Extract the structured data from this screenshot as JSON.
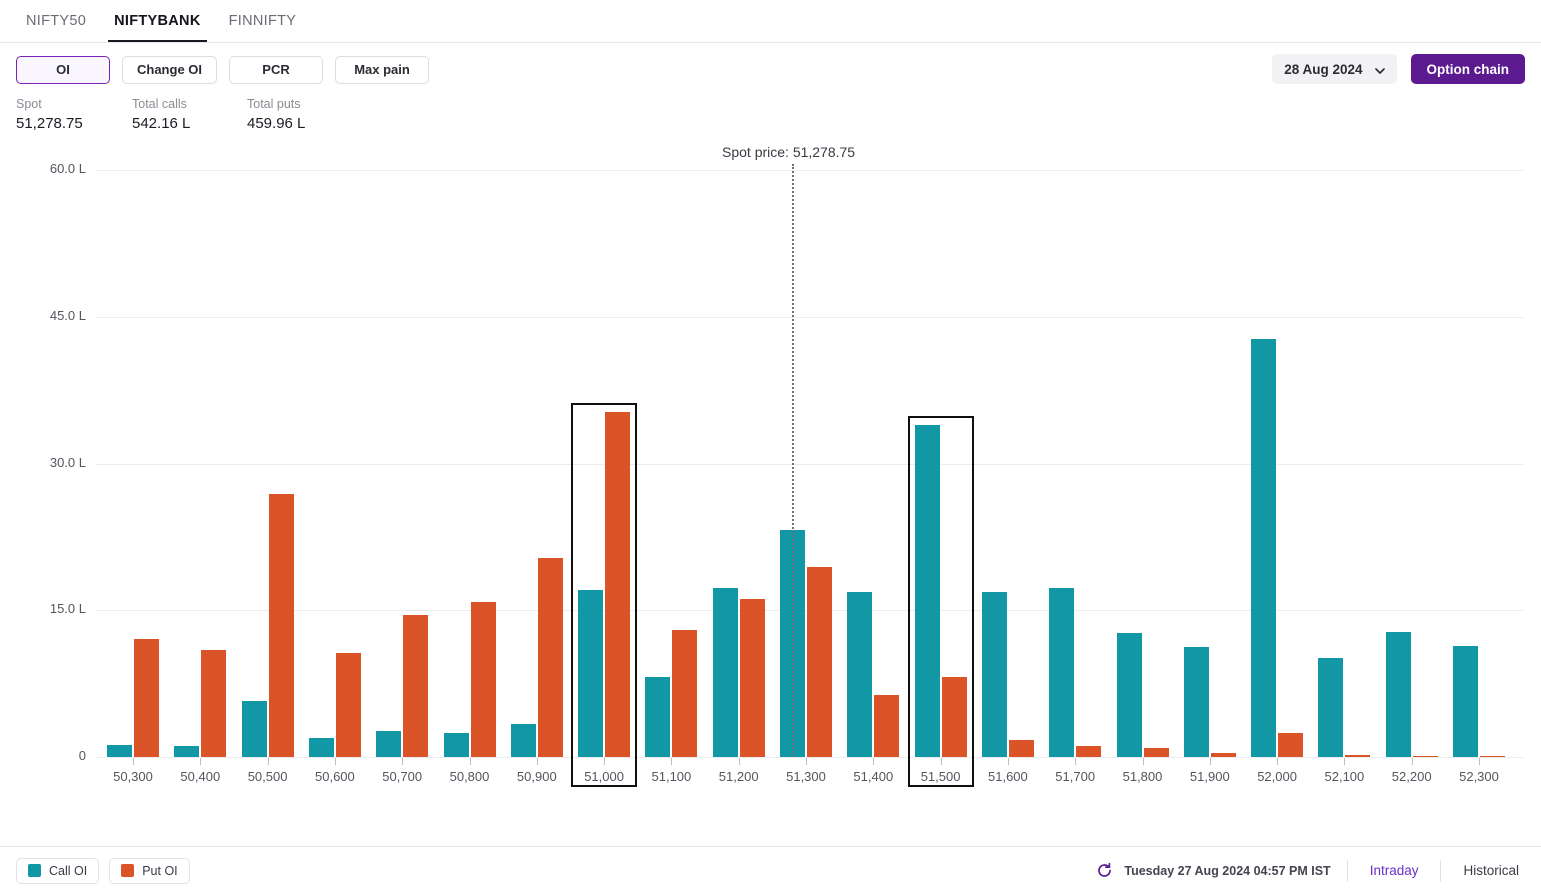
{
  "tabs": [
    {
      "label": "NIFTY50",
      "active": false
    },
    {
      "label": "NIFTYBANK",
      "active": true
    },
    {
      "label": "FINNIFTY",
      "active": false
    }
  ],
  "toolbar": {
    "buttons": [
      {
        "label": "OI",
        "selected": true
      },
      {
        "label": "Change OI",
        "selected": false
      },
      {
        "label": "PCR",
        "selected": false
      },
      {
        "label": "Max pain",
        "selected": false
      }
    ],
    "expiry_date": "28 Aug 2024",
    "expiry_chevron_icon": "chevron-down-icon",
    "option_chain_label": "Option chain"
  },
  "stats": [
    {
      "label": "Spot",
      "value": "51,278.75"
    },
    {
      "label": "Total calls",
      "value": "542.16 L"
    },
    {
      "label": "Total puts",
      "value": "459.96 L"
    }
  ],
  "annotations": {
    "spot_price_label": "Spot price: 51,278.75"
  },
  "footer": {
    "legend": [
      {
        "label": "Call OI",
        "color": "#1297a4"
      },
      {
        "label": "Put OI",
        "color": "#db5427"
      }
    ],
    "refresh_icon": "refresh-icon",
    "timestamp": "Tuesday 27 Aug 2024 04:57 PM IST",
    "links": [
      {
        "label": "Intraday",
        "active": true
      },
      {
        "label": "Historical",
        "active": false
      }
    ]
  },
  "colors": {
    "call": "#1297a4",
    "put": "#db5427",
    "accent": "#5b1a8f",
    "accent_light": "#7a21ba",
    "highlight_outline": "#101014",
    "grid": "#ececf0",
    "text": "#1b1b22",
    "muted": "#8b8b96"
  },
  "chart_data": {
    "type": "bar",
    "title": "",
    "xlabel": "",
    "ylabel": "",
    "ylim": [
      0,
      60
    ],
    "yticks": [
      "0",
      "15.0 L",
      "30.0 L",
      "45.0 L",
      "60.0 L"
    ],
    "ytick_values": [
      0,
      15,
      30,
      45,
      60
    ],
    "grid": true,
    "legend_position": "bottom-left",
    "unit": "L",
    "categories": [
      "50,300",
      "50,400",
      "50,500",
      "50,600",
      "50,700",
      "50,800",
      "50,900",
      "51,000",
      "51,100",
      "51,200",
      "51,300",
      "51,400",
      "51,500",
      "51,600",
      "51,700",
      "51,800",
      "51,900",
      "52,000",
      "52,100",
      "52,200",
      "52,300"
    ],
    "series": [
      {
        "name": "Call OI",
        "color": "#1297a4",
        "values": [
          1.2,
          1.1,
          5.7,
          1.9,
          2.7,
          2.5,
          3.4,
          17.1,
          8.2,
          17.3,
          23.2,
          16.9,
          33.9,
          16.9,
          17.3,
          12.7,
          11.2,
          42.7,
          10.1,
          12.8,
          11.4
        ]
      },
      {
        "name": "Put OI",
        "color": "#db5427",
        "values": [
          12.1,
          10.9,
          26.9,
          10.6,
          14.5,
          15.9,
          20.3,
          35.3,
          13.0,
          16.2,
          19.4,
          6.3,
          8.2,
          1.7,
          1.1,
          0.9,
          0.4,
          2.5,
          0.2,
          0.15,
          0.1
        ]
      }
    ],
    "highlighted_categories": [
      "51,000",
      "51,500"
    ],
    "spot_line": {
      "value": 51278.75,
      "label": "Spot price: 51,278.75",
      "between": [
        "51,200",
        "51,300"
      ]
    }
  }
}
